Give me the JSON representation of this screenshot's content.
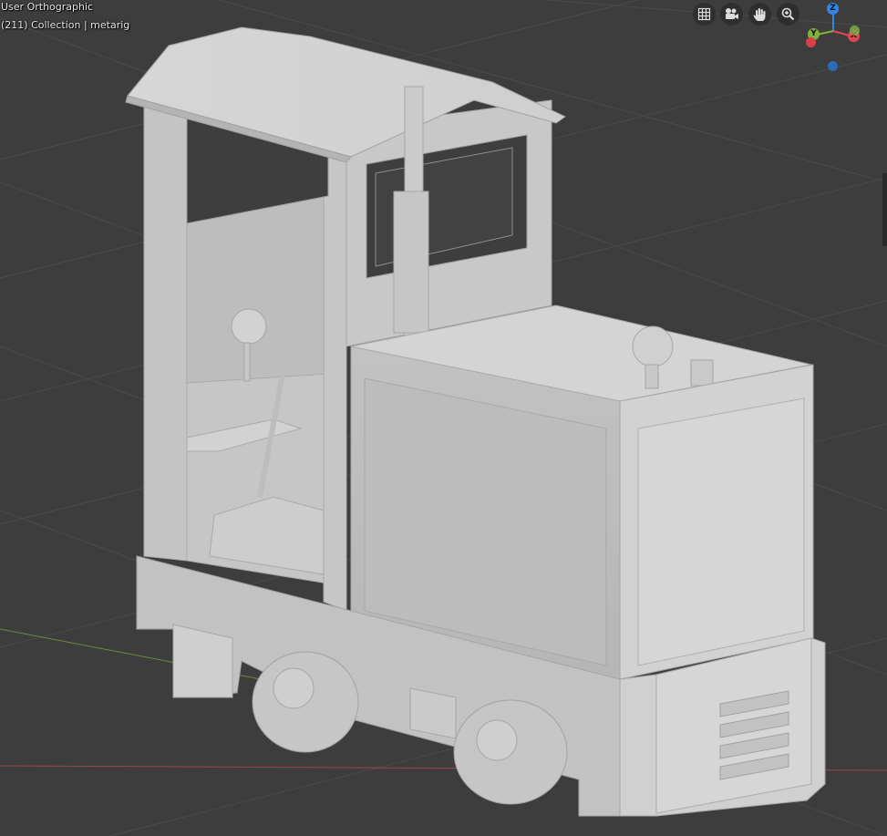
{
  "viewport": {
    "view_name": "User Orthographic",
    "collection_info": "(211) Collection | metarig",
    "background": "#3d3d3d",
    "grid_line": "#4a4a4a",
    "x_axis_color": "#9a4a4a",
    "y_axis_color": "#6b8a3a"
  },
  "navigation": {
    "buttons": [
      {
        "name": "toggle-camera-grid",
        "icon": "grid-icon"
      },
      {
        "name": "camera-view",
        "icon": "camera-icon"
      },
      {
        "name": "pan-view",
        "icon": "hand-icon"
      },
      {
        "name": "zoom-view",
        "icon": "magnifier-icon"
      }
    ]
  },
  "gizmo": {
    "z_label": "Z",
    "y_label": "Y",
    "x_label": "X",
    "z_color": "#2f86e6",
    "y_color": "#7fb43c",
    "x_color": "#e04850",
    "neg_x_color": "#d8404a",
    "neg_z_color": "#2b6cb8"
  },
  "object": {
    "name": "locomotive-model",
    "body_color": "#c9c9c9"
  }
}
